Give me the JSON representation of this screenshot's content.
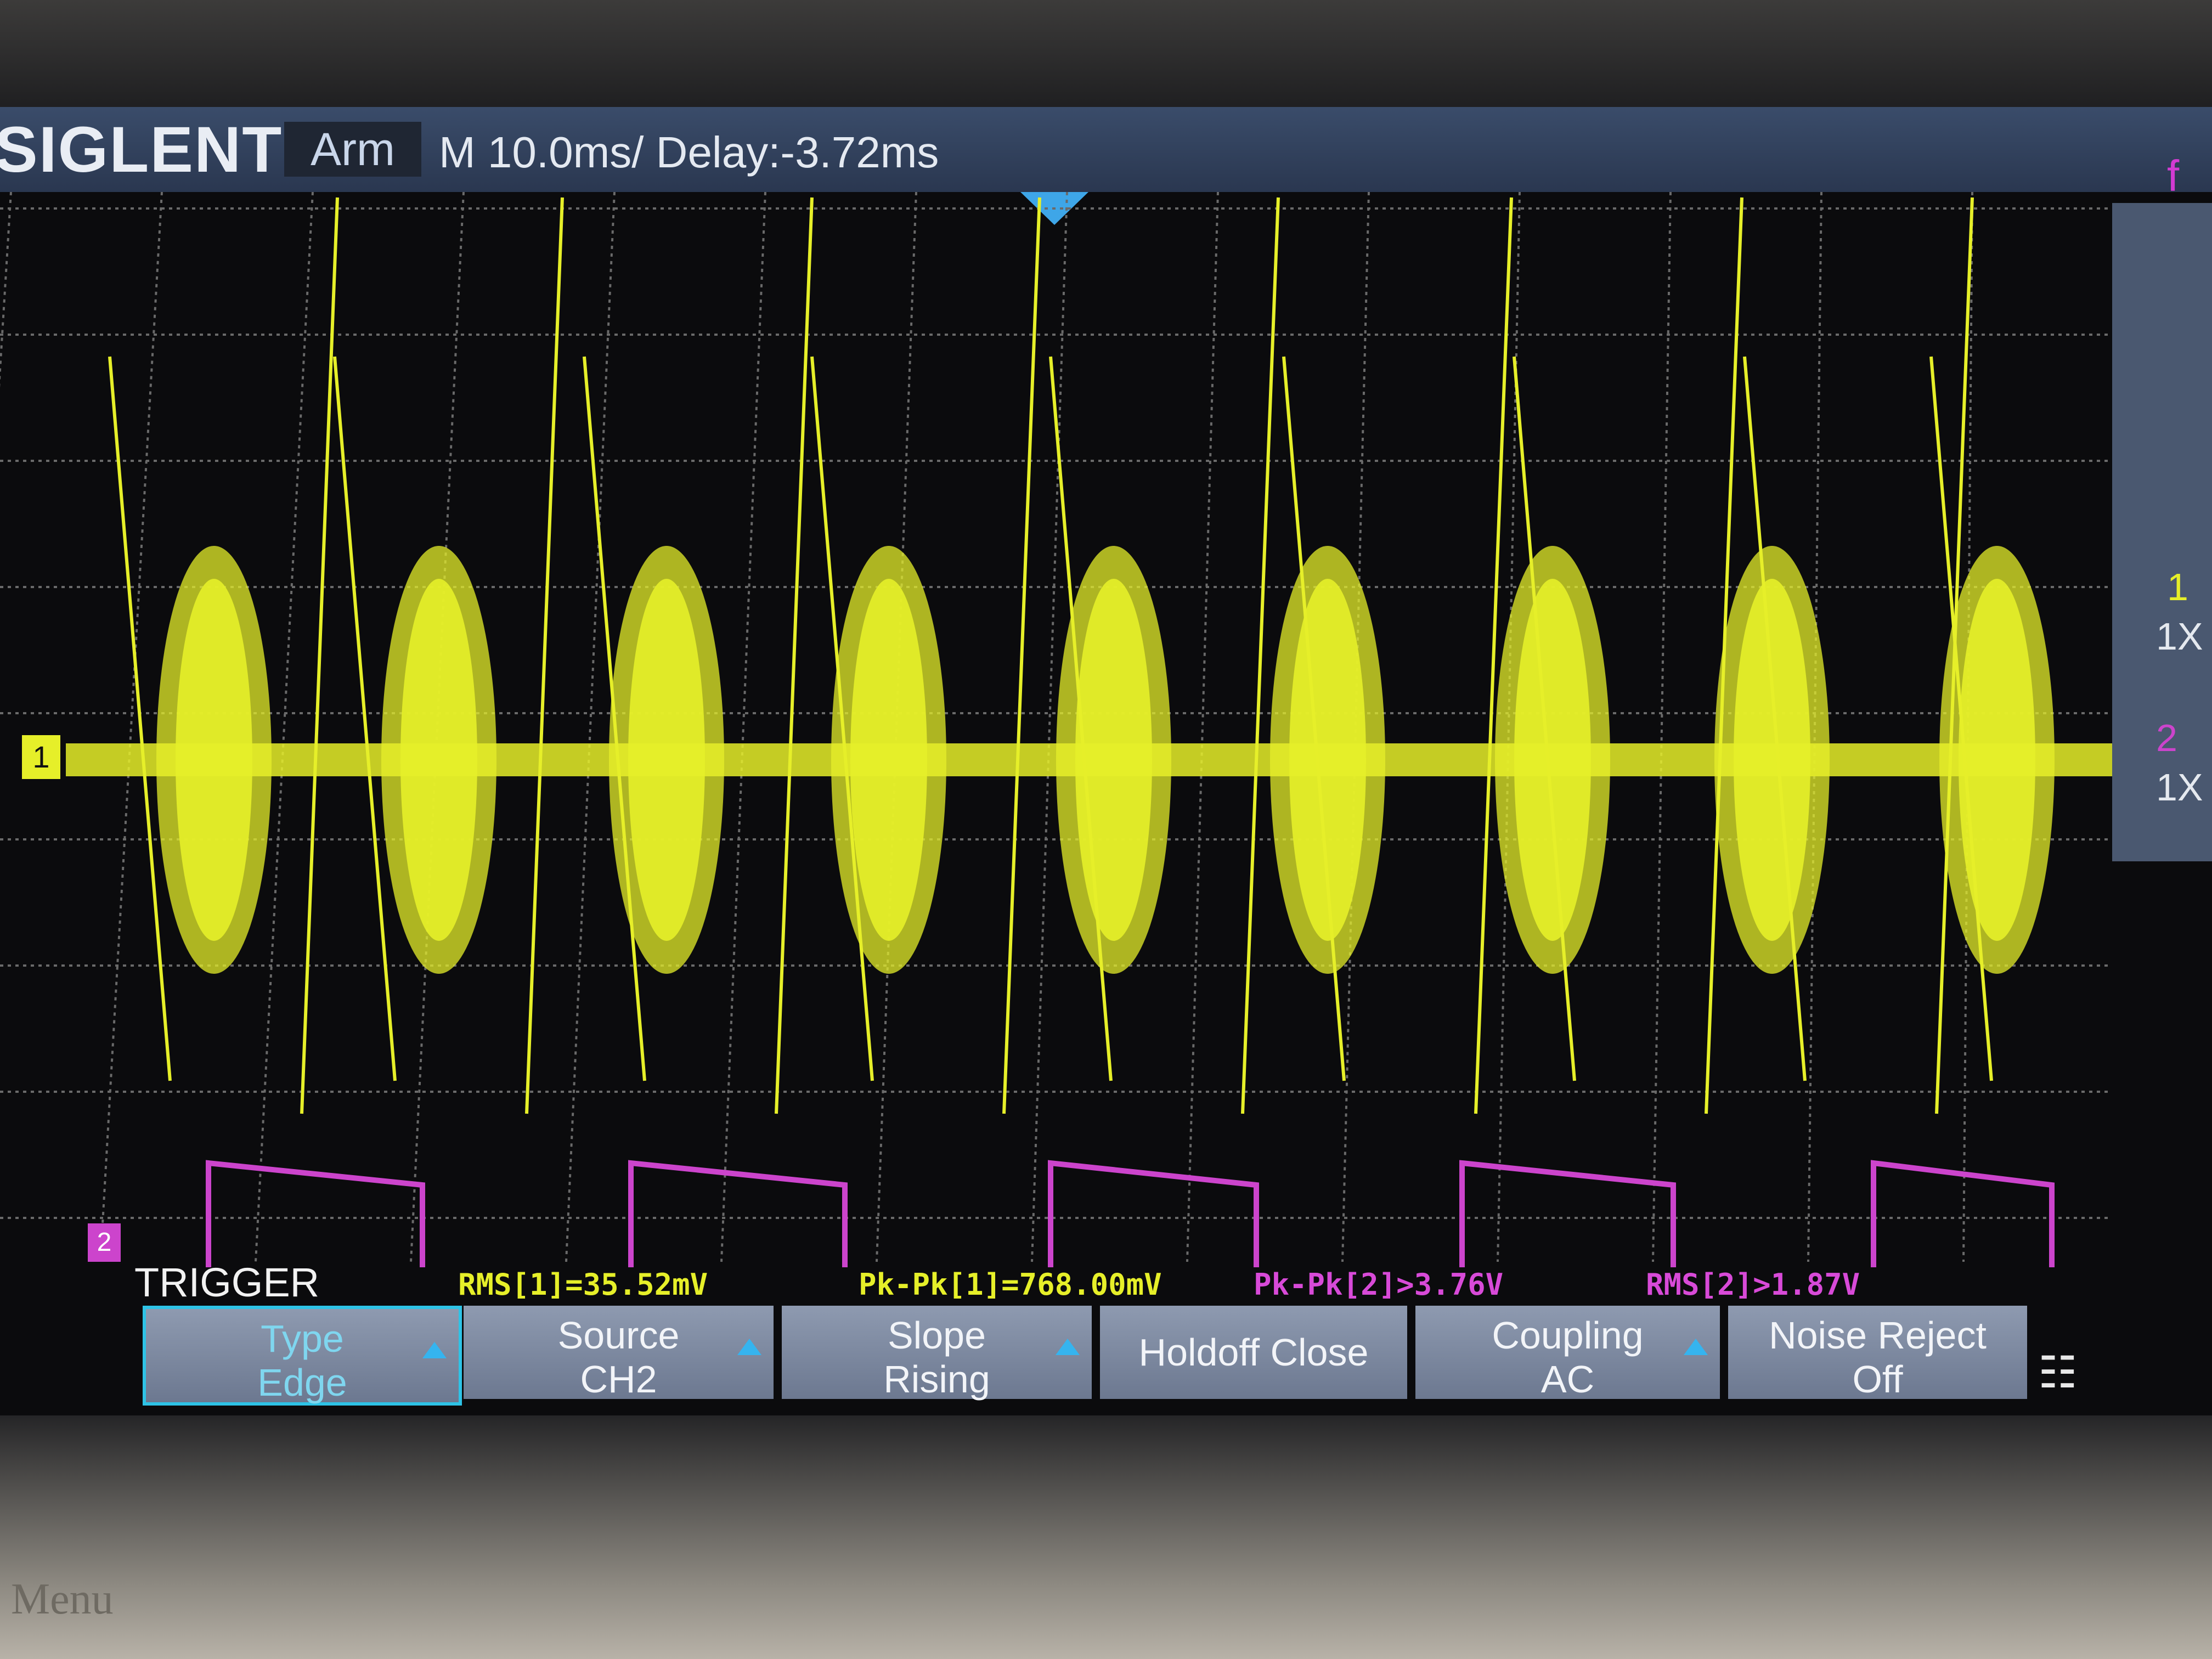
{
  "header": {
    "brand": "SIGLENT",
    "status": "Arm",
    "timebase": "M 10.0ms/ Delay:-3.72ms",
    "freq_marker": "f ="
  },
  "channels": {
    "ch1_marker": "1",
    "ch2_marker": "2",
    "ch1_scale_label": "1",
    "ch1_probe": "1X",
    "ch2_scale_label": "2",
    "ch2_probe": "1X",
    "ch1_color": "#e6ef29",
    "ch2_color": "#cc44cc"
  },
  "trigger": {
    "title": "TRIGGER",
    "type_label": "Type",
    "type_value": "Edge",
    "source_label": "Source",
    "source_value": "CH2",
    "slope_label": "Slope",
    "slope_value": "Rising",
    "holdoff_label": "Holdoff Close",
    "coupling_label": "Coupling",
    "coupling_value": "AC",
    "noise_label": "Noise Reject",
    "noise_value": "Off"
  },
  "measurements": {
    "rms1": "RMS[1]=35.52mV",
    "pkpk1": "Pk-Pk[1]=768.00mV",
    "pkpk2": "Pk-Pk[2]>3.76V",
    "rms2": "RMS[2]>1.87V"
  },
  "hardware": {
    "menu_button": "Menu"
  }
}
